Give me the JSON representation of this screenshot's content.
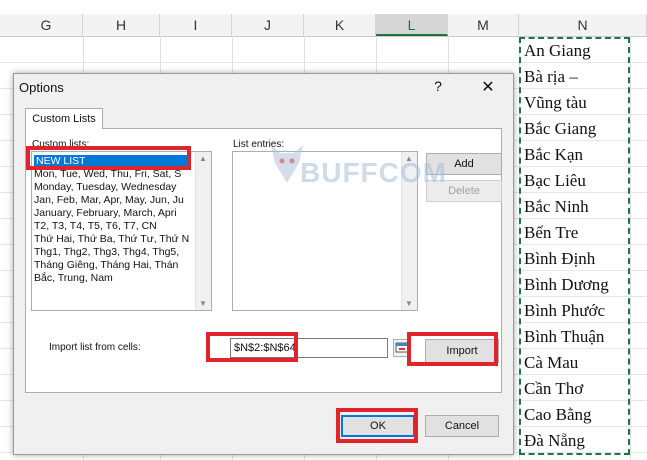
{
  "sheet": {
    "columns": [
      "G",
      "H",
      "I",
      "J",
      "K",
      "L",
      "M",
      "N"
    ],
    "active_column": "L",
    "n_cells": [
      "An Giang",
      "Bà rịa –",
      "Vũng tàu",
      "Bắc Giang",
      "Bắc Kạn",
      "Bạc Liêu",
      "Bắc Ninh",
      "Bến Tre",
      "Bình Định",
      "Bình Dương",
      "Bình Phước",
      "Bình Thuận",
      "Cà Mau",
      "Cần Thơ",
      "Cao Bằng",
      "Đà Nẵng"
    ]
  },
  "dialog": {
    "title": "Options",
    "help": "?",
    "close": "✕",
    "tab": "Custom Lists",
    "custom_lists_label": "Custom lists:",
    "list_entries_label": "List entries:",
    "custom_lists": [
      "NEW LIST",
      "Mon, Tue, Wed, Thu, Fri, Sat, S",
      "Monday, Tuesday, Wednesday",
      "Jan, Feb, Mar, Apr, May, Jun, Ju",
      "January, February, March, Apri",
      "T2, T3, T4, T5, T6, T7, CN",
      "Thứ Hai, Thứ Ba, Thứ Tư, Thứ N",
      "Thg1, Thg2, Thg3, Thg4, Thg5,",
      "Tháng Giêng, Tháng Hai, Thán",
      "Bắc, Trung, Nam"
    ],
    "add_label": "Add",
    "delete_label": "Delete",
    "import_label": "Import list from cells:",
    "import_value": "$N$2:$N$64",
    "import_button": "Import",
    "ok_label": "OK",
    "cancel_label": "Cancel"
  },
  "watermark": {
    "text": "BUFFCOM"
  },
  "colors": {
    "highlight": "#e0242b",
    "selection": "#0078d7",
    "excel_green": "#217346"
  }
}
